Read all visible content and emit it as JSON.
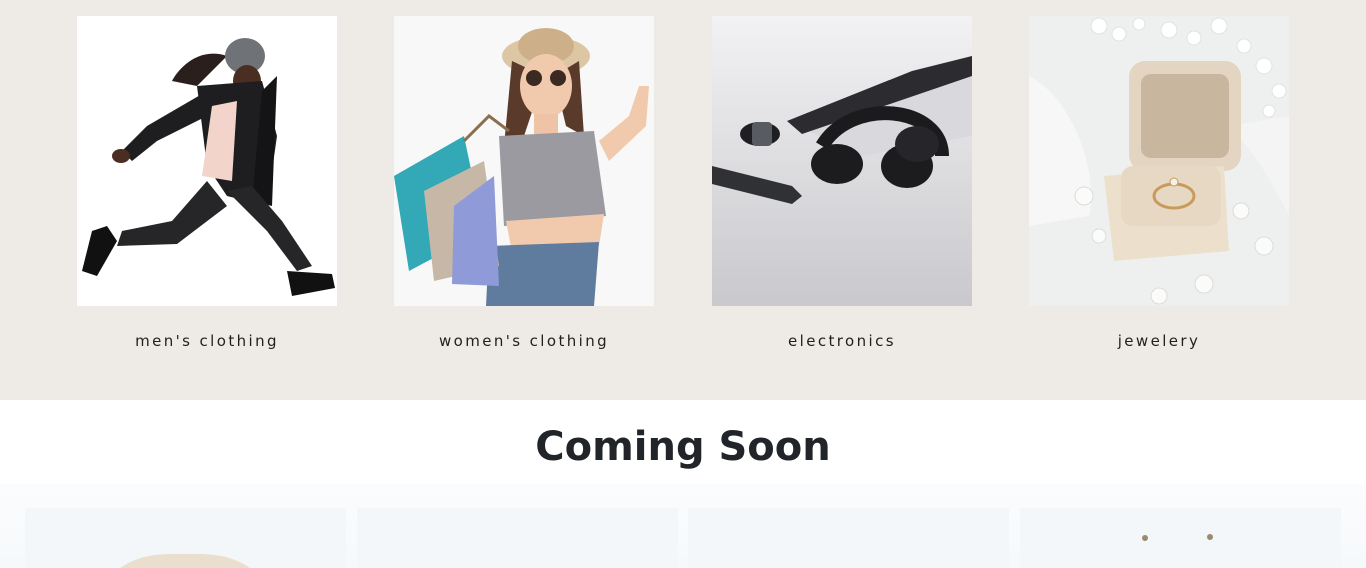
{
  "categories": [
    {
      "label": "men's clothing",
      "image_icon": "jumping-man-photo"
    },
    {
      "label": "women's clothing",
      "image_icon": "woman-shopping-bags-photo"
    },
    {
      "label": "electronics",
      "image_icon": "headphones-laptop-phone-photo"
    },
    {
      "label": "jewelery",
      "image_icon": "ring-box-photo"
    }
  ],
  "coming_soon": {
    "title": "Coming Soon",
    "products": [
      {
        "image_icon": "shirt-photo"
      },
      {
        "image_icon": "product-photo"
      },
      {
        "image_icon": "product-photo"
      },
      {
        "image_icon": "earrings-photo"
      }
    ]
  },
  "colors": {
    "categories_background": "#eeebe6",
    "coming_soon_background": "#f6f9fb",
    "card_background": "#f3f7fa",
    "heading_text": "#212529"
  }
}
